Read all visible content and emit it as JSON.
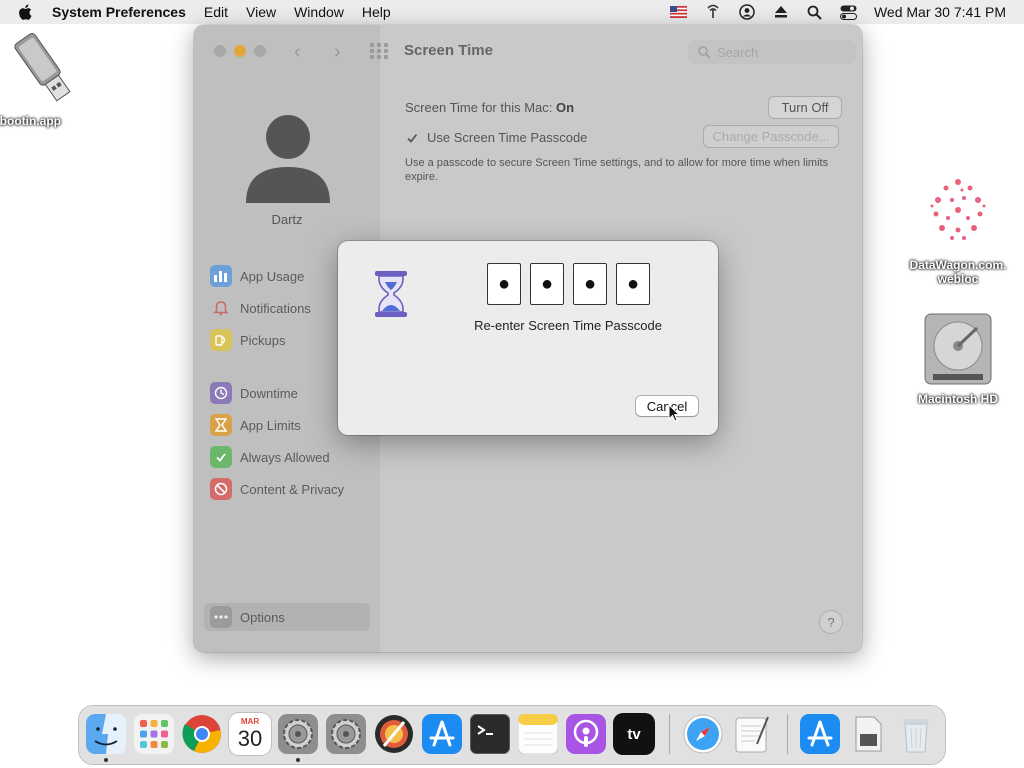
{
  "menubar": {
    "app_name": "System Preferences",
    "menus": [
      "Edit",
      "View",
      "Window",
      "Help"
    ],
    "status_icons": [
      "us-flag-icon",
      "network-icon",
      "user-icon",
      "eject-icon",
      "spotlight-icon",
      "control-center-icon"
    ],
    "clock": "Wed Mar 30  7:41 PM"
  },
  "desktop": {
    "icons": [
      {
        "label": "etbootin.app",
        "icon": "usb-drive-icon"
      },
      {
        "label": "DataWagon.com.webloc",
        "icon": "webloc-icon"
      },
      {
        "label": "Macintosh HD",
        "icon": "hard-drive-icon"
      }
    ],
    "datawagon_line1": "DataWagon.com.",
    "datawagon_line2": "webloc"
  },
  "window": {
    "title": "Screen Time",
    "search_placeholder": "Search",
    "user_name": "Dartz",
    "sidebar_items": [
      {
        "label": "App Usage",
        "icon": "bar-chart-icon",
        "color": "#6d9fd8"
      },
      {
        "label": "Notifications",
        "icon": "bell-icon",
        "color": "#d37a7a"
      },
      {
        "label": "Pickups",
        "icon": "pickups-icon",
        "color": "#d9c45a"
      },
      {
        "label": "Downtime",
        "icon": "downtime-icon",
        "color": "#8c7ab8"
      },
      {
        "label": "App Limits",
        "icon": "hourglass-icon",
        "color": "#d9a24a"
      },
      {
        "label": "Always Allowed",
        "icon": "checkmark-shield-icon",
        "color": "#6bb86b"
      },
      {
        "label": "Content & Privacy",
        "icon": "no-entry-icon",
        "color": "#d36b6b"
      }
    ],
    "options_label": "Options",
    "status_prefix": "Screen Time for this Mac:",
    "status_value": "On",
    "turn_off_label": "Turn Off",
    "use_passcode_label": "Use Screen Time Passcode",
    "use_passcode_checked": true,
    "change_passcode_label": "Change Passcode...",
    "passcode_description": "Use a passcode to secure Screen Time settings, and to allow for more time when limits expire.",
    "help_label": "?"
  },
  "dialog": {
    "digits": [
      "●",
      "●",
      "●",
      "●"
    ],
    "message": "Re-enter Screen Time Passcode",
    "cancel_label": "Cancel"
  },
  "dock": {
    "apps": [
      "Finder",
      "Launchpad",
      "Google Chrome",
      "Calendar",
      "System Preferences",
      "System Preferences",
      "Digital Color Meter",
      "App Store",
      "Terminal",
      "Notes",
      "Podcasts",
      "TV",
      "Safari",
      "TextEdit",
      "App Store",
      "Preview",
      "Trash"
    ],
    "calendar_month": "MAR",
    "calendar_day": "30"
  }
}
